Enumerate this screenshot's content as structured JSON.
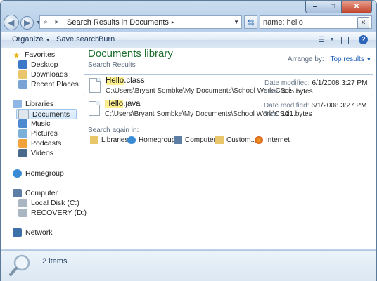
{
  "window": {
    "controls": {
      "minimize": "–",
      "maximize": "□",
      "close": "✕"
    }
  },
  "navigation": {
    "back_icon": "back-arrow-icon",
    "forward_icon": "forward-arrow-icon"
  },
  "address_bar": {
    "breadcrumb": "Search Results in Documents"
  },
  "search": {
    "value": "name: hello"
  },
  "toolbar": {
    "organize": "Organize",
    "save_search": "Save search",
    "burn": "Burn"
  },
  "sidebar": {
    "favorites_header": "Favorites",
    "favorites": [
      "Desktop",
      "Downloads",
      "Recent Places"
    ],
    "libraries_header": "Libraries",
    "libraries": [
      "Documents",
      "Music",
      "Pictures",
      "Podcasts",
      "Videos"
    ],
    "homegroup": "Homegroup",
    "computer_header": "Computer",
    "drives": [
      "Local Disk (C:)",
      "RECOVERY (D:)"
    ],
    "network": "Network"
  },
  "main": {
    "title": "Documents library",
    "subtitle": "Search Results",
    "arrange_label": "Arrange by:",
    "arrange_value": "Top results",
    "results": [
      {
        "name_highlight": "Hello",
        "name_rest": ".class",
        "path": "C:\\Users\\Bryant Sombke\\My Documents\\School Work\\CSci...",
        "date_label": "Date modified:",
        "date_value": "6/1/2008 3:27 PM",
        "size_label": "Size:",
        "size_value": "415 bytes"
      },
      {
        "name_highlight": "Hello",
        "name_rest": ".java",
        "path": "C:\\Users\\Bryant Sombke\\My Documents\\School Work\\CSci...",
        "date_label": "Date modified:",
        "date_value": "6/1/2008 3:27 PM",
        "size_label": "Size:",
        "size_value": "121 bytes"
      }
    ],
    "search_again_label": "Search again in:",
    "search_again": [
      "Libraries",
      "Homegroup",
      "Computer",
      "Custom...",
      "Internet"
    ]
  },
  "details": {
    "item_count": "2 items"
  },
  "colors": {
    "library_title": "#1e6e2e",
    "highlight": "#fff190",
    "link": "#1c5fb6"
  }
}
